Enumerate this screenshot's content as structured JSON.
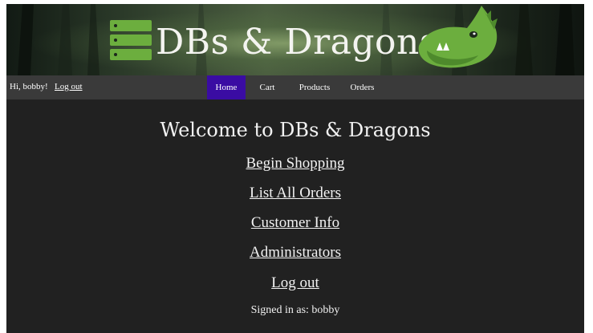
{
  "banner": {
    "logo_text": "DBs & Dragons"
  },
  "navbar": {
    "greeting": "Hi, bobby!",
    "logout_label": "Log out",
    "items": [
      {
        "label": "Home",
        "active": true
      },
      {
        "label": "Cart"
      },
      {
        "label": "Products"
      },
      {
        "label": "Orders"
      }
    ],
    "active_color": "#3a0ca3"
  },
  "main": {
    "title": "Welcome to DBs & Dragons",
    "links": [
      {
        "label": "Begin Shopping"
      },
      {
        "label": "List All Orders"
      },
      {
        "label": "Customer Info"
      },
      {
        "label": "Administrators"
      },
      {
        "label": "Log out"
      }
    ],
    "signed_in": "Signed in as: bobby"
  },
  "colors": {
    "background": "#212121",
    "navbar": "#3a3a3a",
    "logo_green": "#6cae3e",
    "text": "#f2f2f2"
  }
}
